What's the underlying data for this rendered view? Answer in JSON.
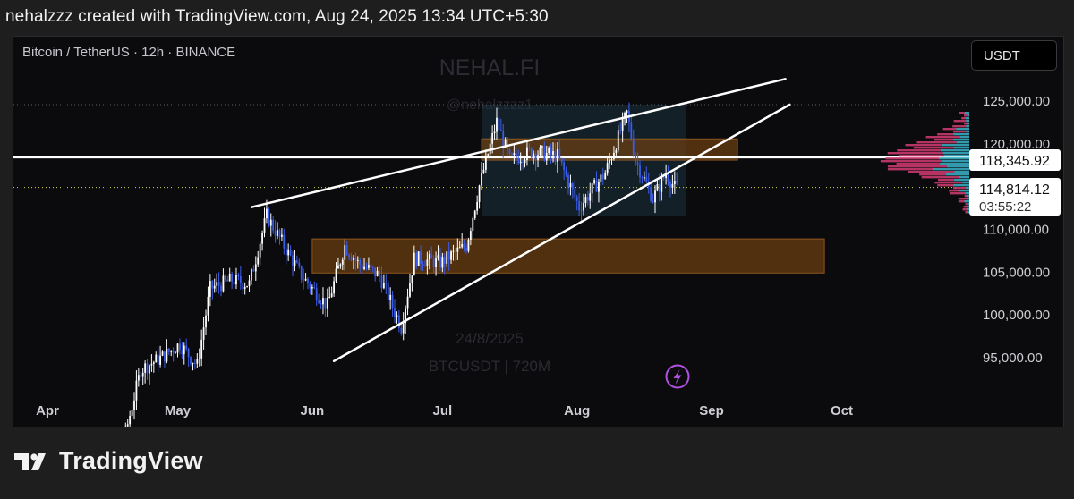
{
  "header": {
    "caption": "nehalzzz created with TradingView.com, Aug 24, 2025 13:34 UTC+5:30"
  },
  "chart": {
    "symbol_label": "Bitcoin / TetherUS · 12h · BINANCE",
    "currency": "USDT",
    "watermark_title": "NEHAL.FI",
    "watermark_handle": "@nehalzzzz1",
    "watermark_date": "24/8/2025",
    "watermark_ticker": "BTCUSDT | 720M",
    "resistance_price_label": "118,345.92",
    "last_price_label": "114,814.12",
    "countdown_label": "03:55:22"
  },
  "footer": {
    "brand": "TradingView"
  },
  "colors": {
    "up_candle": "#ffffff",
    "down_candle": "#3a5ce8",
    "zone_fill": "#6b3f10",
    "trendline": "#ffffff",
    "last_price_line": "#d8d84a",
    "profile_pink": "#d43c72",
    "profile_cyan": "#3ab4c8",
    "lightning": "#b052e0"
  },
  "chart_data": {
    "type": "candlestick",
    "interval": "12h",
    "y_ticks": [
      {
        "value": 95000,
        "label": "95,000.00"
      },
      {
        "value": 100000,
        "label": "100,000.00"
      },
      {
        "value": 105000,
        "label": "105,000.00"
      },
      {
        "value": 110000,
        "label": "110,000.00"
      },
      {
        "value": 120000,
        "label": "120,000.00"
      },
      {
        "value": 125000,
        "label": "125,000.00"
      }
    ],
    "x_ticks": [
      {
        "date": "2025-04-01",
        "label": "Apr"
      },
      {
        "date": "2025-05-01",
        "label": "May"
      },
      {
        "date": "2025-06-01",
        "label": "Jun"
      },
      {
        "date": "2025-07-01",
        "label": "Jul"
      },
      {
        "date": "2025-08-01",
        "label": "Aug"
      },
      {
        "date": "2025-09-01",
        "label": "Sep"
      },
      {
        "date": "2025-10-01",
        "label": "Oct"
      }
    ],
    "price_path": [
      [
        "2025-04-09",
        76000
      ],
      [
        "2025-04-14",
        84500
      ],
      [
        "2025-04-19",
        85000
      ],
      [
        "2025-04-23",
        93500
      ],
      [
        "2025-04-28",
        95000
      ],
      [
        "2025-05-02",
        96500
      ],
      [
        "2025-05-06",
        94000
      ],
      [
        "2025-05-09",
        103000
      ],
      [
        "2025-05-14",
        104000
      ],
      [
        "2025-05-18",
        103500
      ],
      [
        "2025-05-22",
        111500
      ],
      [
        "2025-05-26",
        108000
      ],
      [
        "2025-05-30",
        104500
      ],
      [
        "2025-06-05",
        101000
      ],
      [
        "2025-06-09",
        108000
      ],
      [
        "2025-06-12",
        106000
      ],
      [
        "2025-06-17",
        104500
      ],
      [
        "2025-06-22",
        98500
      ],
      [
        "2025-06-25",
        106500
      ],
      [
        "2025-07-01",
        106000
      ],
      [
        "2025-07-07",
        108000
      ],
      [
        "2025-07-10",
        115000
      ],
      [
        "2025-07-14",
        122500
      ],
      [
        "2025-07-17",
        118000
      ],
      [
        "2025-07-22",
        119000
      ],
      [
        "2025-07-28",
        118500
      ],
      [
        "2025-08-02",
        112500
      ],
      [
        "2025-08-08",
        116500
      ],
      [
        "2025-08-13",
        123500
      ],
      [
        "2025-08-15",
        118000
      ],
      [
        "2025-08-19",
        113500
      ],
      [
        "2025-08-22",
        116500
      ],
      [
        "2025-08-24",
        114814
      ]
    ],
    "zones": [
      {
        "from": "2025-07-10",
        "to": "2025-09-07",
        "low": 118000,
        "high": 120500
      },
      {
        "from": "2025-06-01",
        "to": "2025-09-27",
        "low": 104800,
        "high": 108800
      }
    ],
    "consolidation_box": {
      "from": "2025-07-10",
      "to": "2025-08-26",
      "low": 111500,
      "high": 124500
    },
    "trendlines": [
      {
        "from": [
          "2025-05-18",
          112500
        ],
        "to": [
          "2025-09-18",
          127500
        ]
      },
      {
        "from": [
          "2025-06-06",
          94500
        ],
        "to": [
          "2025-09-19",
          124500
        ]
      }
    ],
    "horizontal_lines": [
      {
        "price": 118345.92,
        "style": "solid"
      },
      {
        "price": 114814.12,
        "style": "dotted"
      },
      {
        "price": 124500,
        "style": "dotted"
      }
    ],
    "last_price": 114814.12,
    "resistance": 118345.92
  }
}
